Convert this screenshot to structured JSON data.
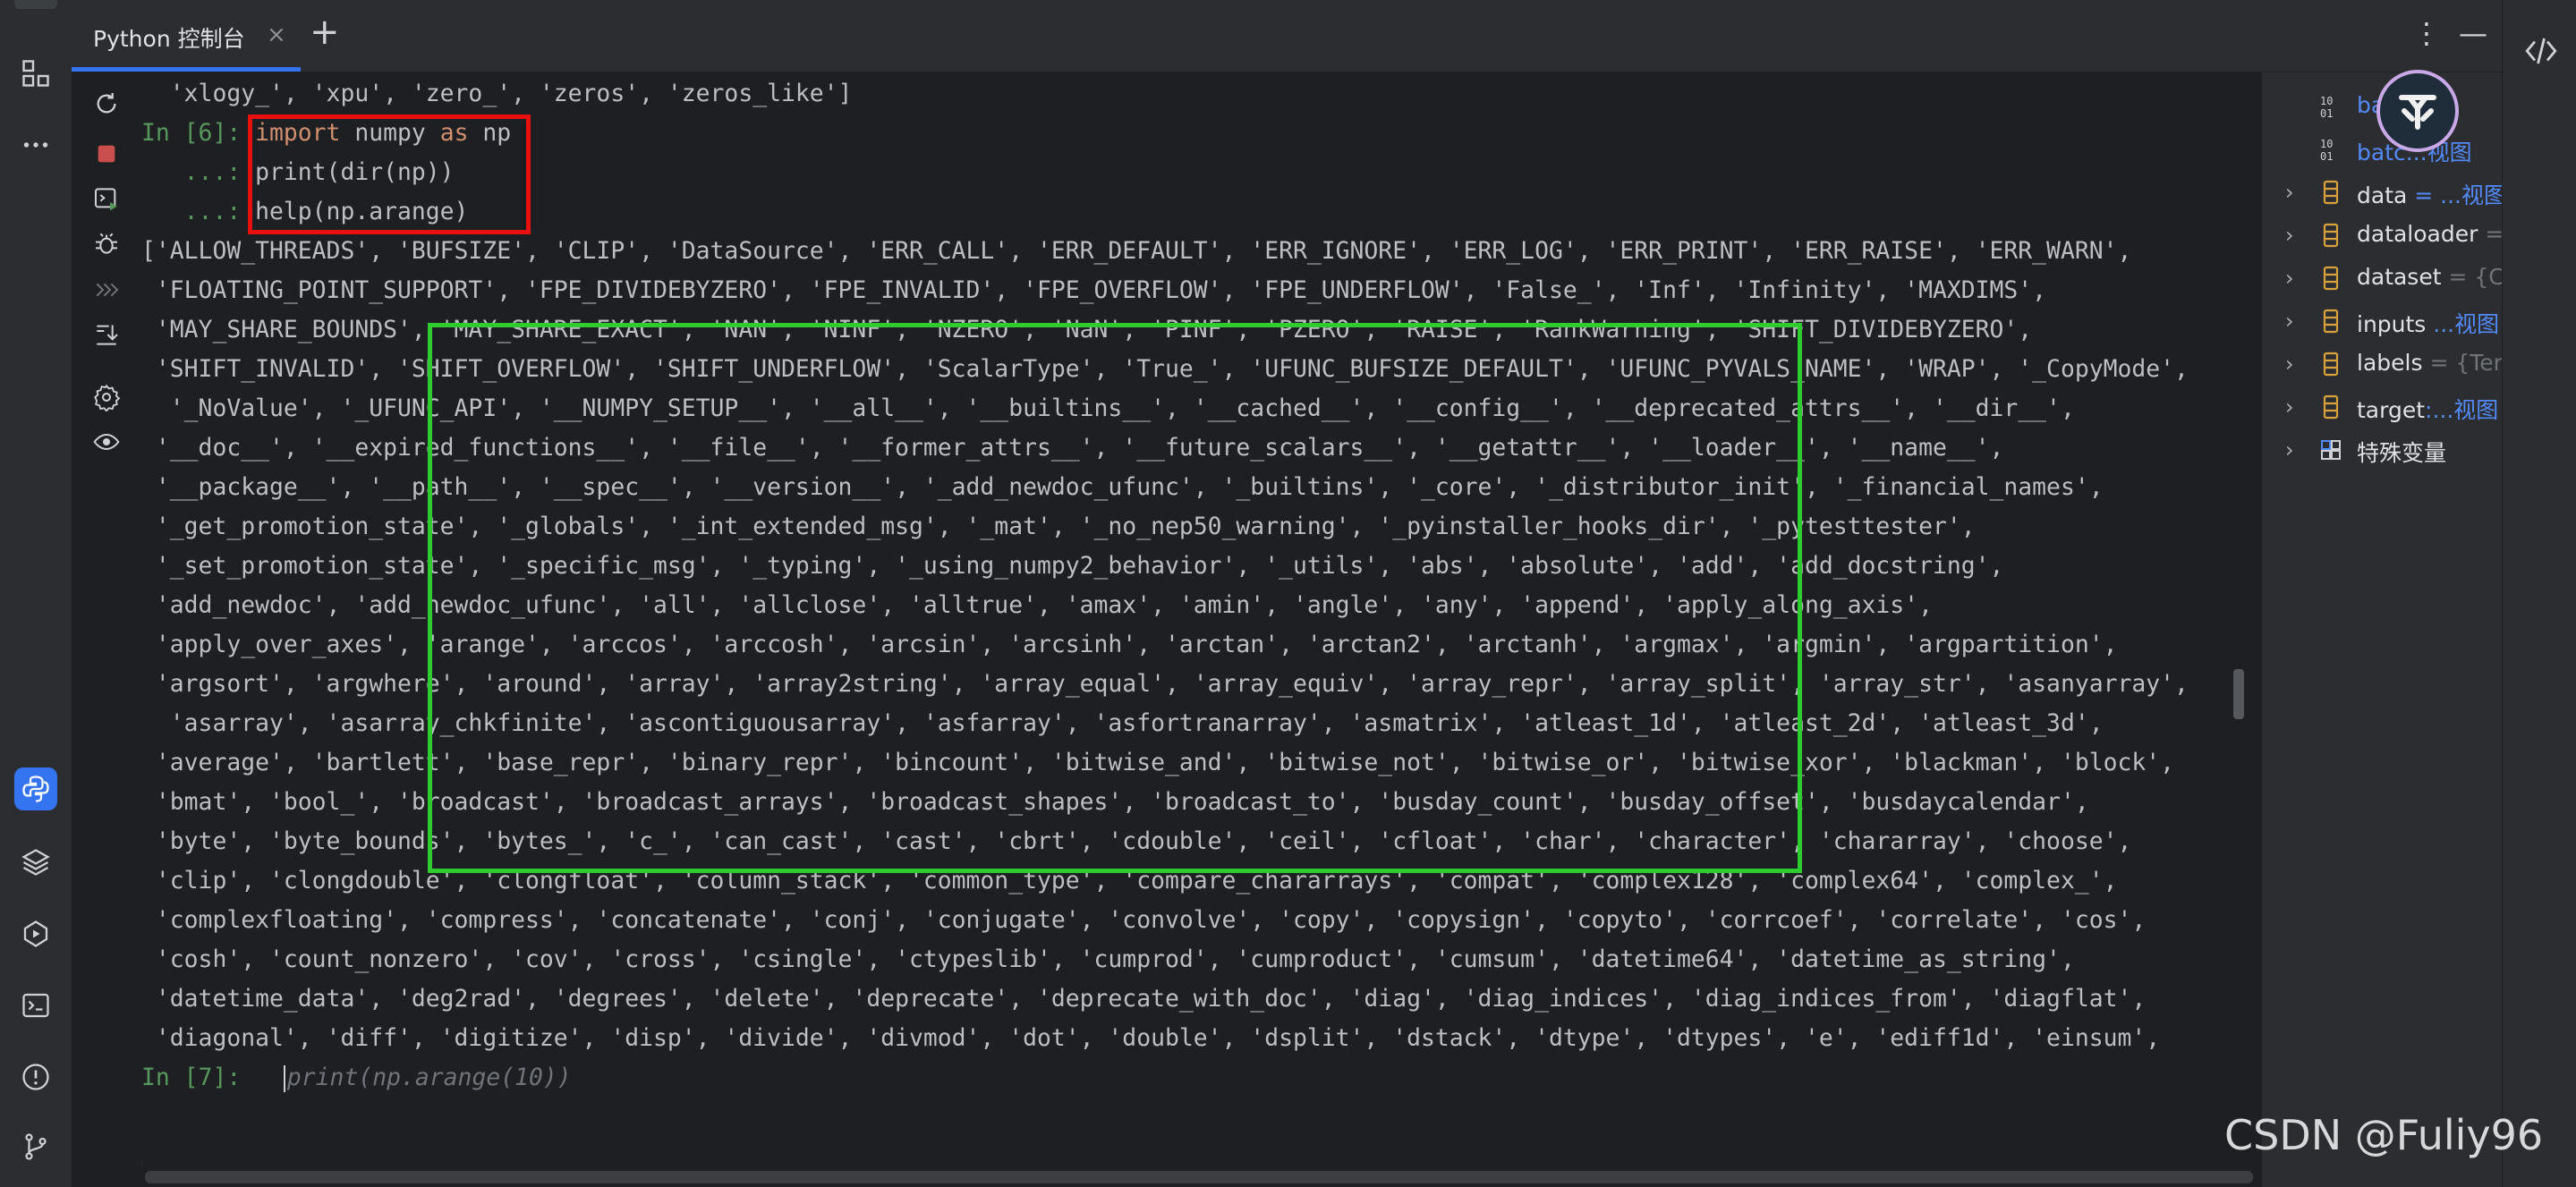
{
  "tab": {
    "label": "Python 控制台",
    "close": "×",
    "add": "+"
  },
  "window_controls": {
    "menu": "⋮",
    "minimize": "—"
  },
  "console_lines": [
    {
      "kind": "output",
      "text": "  'xlogy_', 'xpu', 'zero_', 'zeros', 'zeros_like']"
    },
    {
      "kind": "input",
      "prompt": "In [6]: ",
      "kw1": "import",
      "mid": " numpy ",
      "kw2": "as",
      "rest": " np"
    },
    {
      "kind": "cont",
      "prompt": "   ...: ",
      "text": "print(dir(np))"
    },
    {
      "kind": "cont",
      "prompt": "   ...: ",
      "text": "help(np.arange)"
    },
    {
      "kind": "output",
      "text": "['ALLOW_THREADS', 'BUFSIZE', 'CLIP', 'DataSource', 'ERR_CALL', 'ERR_DEFAULT', 'ERR_IGNORE', 'ERR_LOG', 'ERR_PRINT', 'ERR_RAISE', 'ERR_WARN',"
    },
    {
      "kind": "output",
      "text": " 'FLOATING_POINT_SUPPORT', 'FPE_DIVIDEBYZERO', 'FPE_INVALID', 'FPE_OVERFLOW', 'FPE_UNDERFLOW', 'False_', 'Inf', 'Infinity', 'MAXDIMS',"
    },
    {
      "kind": "output",
      "text": " 'MAY_SHARE_BOUNDS', 'MAY_SHARE_EXACT', 'NAN', 'NINF', 'NZERO', 'NaN', 'PINF', 'PZERO', 'RAISE', 'RankWarning', 'SHIFT_DIVIDEBYZERO',"
    },
    {
      "kind": "output",
      "text": " 'SHIFT_INVALID', 'SHIFT_OVERFLOW', 'SHIFT_UNDERFLOW', 'ScalarType', 'True_', 'UFUNC_BUFSIZE_DEFAULT', 'UFUNC_PYVALS_NAME', 'WRAP', '_CopyMode',"
    },
    {
      "kind": "output",
      "text": "  '_NoValue', '_UFUNC_API', '__NUMPY_SETUP__', '__all__', '__builtins__', '__cached__', '__config__', '__deprecated_attrs__', '__dir__',"
    },
    {
      "kind": "output",
      "text": " '__doc__', '__expired_functions__', '__file__', '__former_attrs__', '__future_scalars__', '__getattr__', '__loader__', '__name__',"
    },
    {
      "kind": "output",
      "text": " '__package__', '__path__', '__spec__', '__version__', '_add_newdoc_ufunc', '_builtins', '_core', '_distributor_init', '_financial_names',"
    },
    {
      "kind": "output",
      "text": " '_get_promotion_state', '_globals', '_int_extended_msg', '_mat', '_no_nep50_warning', '_pyinstaller_hooks_dir', '_pytesttester',"
    },
    {
      "kind": "output",
      "text": " '_set_promotion_state', '_specific_msg', '_typing', '_using_numpy2_behavior', '_utils', 'abs', 'absolute', 'add', 'add_docstring',"
    },
    {
      "kind": "output",
      "text": " 'add_newdoc', 'add_newdoc_ufunc', 'all', 'allclose', 'alltrue', 'amax', 'amin', 'angle', 'any', 'append', 'apply_along_axis',"
    },
    {
      "kind": "output",
      "text": " 'apply_over_axes', 'arange', 'arccos', 'arccosh', 'arcsin', 'arcsinh', 'arctan', 'arctan2', 'arctanh', 'argmax', 'argmin', 'argpartition',"
    },
    {
      "kind": "output",
      "text": " 'argsort', 'argwhere', 'around', 'array', 'array2string', 'array_equal', 'array_equiv', 'array_repr', 'array_split', 'array_str', 'asanyarray',"
    },
    {
      "kind": "output",
      "text": "  'asarray', 'asarray_chkfinite', 'ascontiguousarray', 'asfarray', 'asfortranarray', 'asmatrix', 'atleast_1d', 'atleast_2d', 'atleast_3d',"
    },
    {
      "kind": "output",
      "text": " 'average', 'bartlett', 'base_repr', 'binary_repr', 'bincount', 'bitwise_and', 'bitwise_not', 'bitwise_or', 'bitwise_xor', 'blackman', 'block',"
    },
    {
      "kind": "output",
      "text": " 'bmat', 'bool_', 'broadcast', 'broadcast_arrays', 'broadcast_shapes', 'broadcast_to', 'busday_count', 'busday_offset', 'busdaycalendar',"
    },
    {
      "kind": "output",
      "text": " 'byte', 'byte_bounds', 'bytes_', 'c_', 'can_cast', 'cast', 'cbrt', 'cdouble', 'ceil', 'cfloat', 'char', 'character', 'chararray', 'choose',"
    },
    {
      "kind": "output",
      "text": " 'clip', 'clongdouble', 'clongfloat', 'column_stack', 'common_type', 'compare_chararrays', 'compat', 'complex128', 'complex64', 'complex_',"
    },
    {
      "kind": "output",
      "text": " 'complexfloating', 'compress', 'concatenate', 'conj', 'conjugate', 'convolve', 'copy', 'copysign', 'copyto', 'corrcoef', 'correlate', 'cos',"
    },
    {
      "kind": "output",
      "text": " 'cosh', 'count_nonzero', 'cov', 'cross', 'csingle', 'ctypeslib', 'cumprod', 'cumproduct', 'cumsum', 'datetime64', 'datetime_as_string',"
    },
    {
      "kind": "output",
      "text": " 'datetime_data', 'deg2rad', 'degrees', 'delete', 'deprecate', 'deprecate_with_doc', 'diag', 'diag_indices', 'diag_indices_from', 'diagflat',"
    },
    {
      "kind": "output",
      "text": " 'diagonal', 'diff', 'digitize', 'disp', 'divide', 'divmod', 'dot', 'double', 'dsplit', 'dstack', 'dtype', 'dtypes', 'e', 'ediff1d', 'einsum',"
    },
    {
      "kind": "prompt_ghost",
      "prompt": "In [7]:   ",
      "ghost": "print(np.arange(10))"
    }
  ],
  "variables": [
    {
      "expand": "",
      "icon": "num",
      "name": "bat",
      "value": "= {",
      "blue": true
    },
    {
      "expand": "",
      "icon": "num",
      "name": "batc",
      "value": "...视图",
      "blue": true
    },
    {
      "expand": "›",
      "icon": "list",
      "name": "data",
      "value": " = ...视图",
      "blue": false
    },
    {
      "expand": "›",
      "icon": "list",
      "name": "dataloader",
      "value": " =",
      "blue": false
    },
    {
      "expand": "›",
      "icon": "list",
      "name": "dataset",
      "value": " = {C",
      "blue": false
    },
    {
      "expand": "›",
      "icon": "list",
      "name": "inputs",
      "value": " ...视图",
      "blue": false
    },
    {
      "expand": "›",
      "icon": "list",
      "name": "labels",
      "value": " = {Ter",
      "blue": false
    },
    {
      "expand": "›",
      "icon": "list",
      "name": "target",
      "value": ":...视图",
      "blue": false
    },
    {
      "expand": "›",
      "icon": "grid",
      "name": "特殊变量",
      "value": "",
      "blue": false
    }
  ],
  "watermark": "CSDN @Fuliy96",
  "colors": {
    "accent": "#3574f0",
    "red_box": "#e8100f",
    "green_box": "#2ecc2f",
    "prompt": "#57965c",
    "keyword": "#cf8e6d"
  }
}
